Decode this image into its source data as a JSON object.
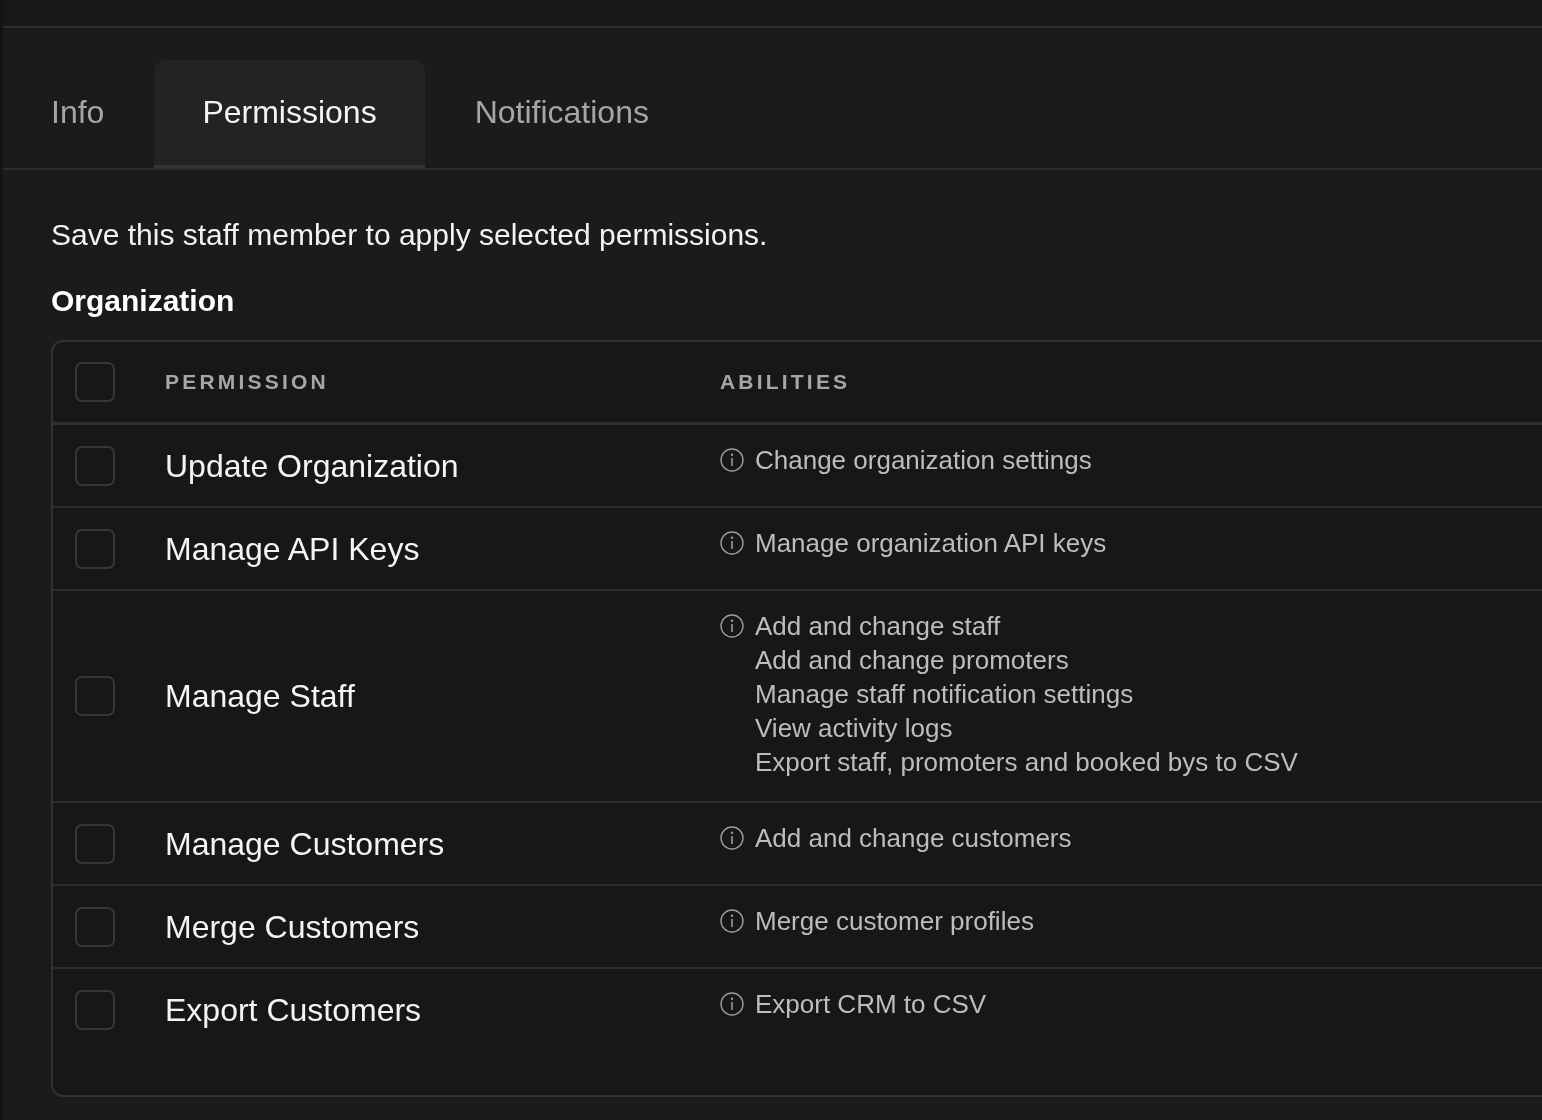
{
  "tabs": [
    {
      "label": "Info",
      "selected": false
    },
    {
      "label": "Permissions",
      "selected": true
    },
    {
      "label": "Notifications",
      "selected": false
    }
  ],
  "notice": "Save this staff member to apply selected permissions.",
  "section": {
    "title": "Organization",
    "table": {
      "select_all": {
        "checked": false
      },
      "columns": [
        "PERMISSION",
        "ABILITIES"
      ],
      "rows": [
        {
          "checked": false,
          "permission": "Update Organization",
          "abilities": [
            "Change organization settings"
          ]
        },
        {
          "checked": false,
          "permission": "Manage API Keys",
          "abilities": [
            "Manage organization API keys"
          ]
        },
        {
          "checked": false,
          "permission": "Manage Staff",
          "abilities": [
            "Add and change staff",
            "Add and change promoters",
            "Manage staff notification settings",
            "View activity logs",
            "Export staff, promoters and booked bys to CSV"
          ]
        },
        {
          "checked": false,
          "permission": "Manage Customers",
          "abilities": [
            "Add and change customers"
          ]
        },
        {
          "checked": false,
          "permission": "Merge Customers",
          "abilities": [
            "Merge customer profiles"
          ]
        },
        {
          "checked": false,
          "permission": "Export Customers",
          "abilities": [
            "Export CRM to CSV"
          ]
        }
      ]
    }
  }
}
